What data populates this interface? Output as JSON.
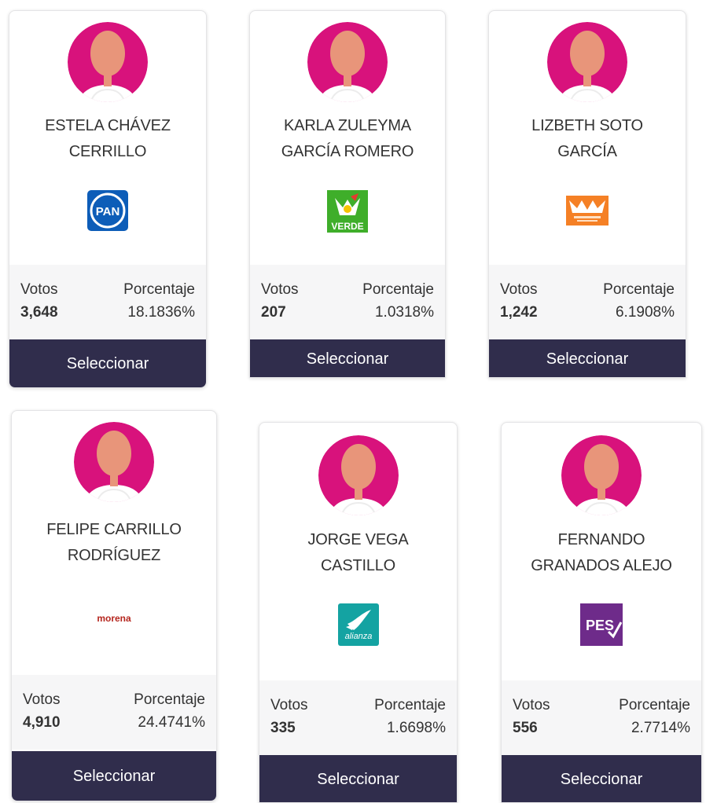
{
  "labels": {
    "votes": "Votos",
    "percent": "Porcentaje",
    "select": "Seleccionar"
  },
  "colors": {
    "avatar_bg": "#d8127c",
    "skin": "#e8957a",
    "button_bg": "#302d4c",
    "stats_bg": "#f6f6f7",
    "pan_blue": "#0d5db8",
    "verde_green": "#3fae2a",
    "mc_orange": "#f58025",
    "morena_red": "#b5261e",
    "alianza_teal": "#14a3a2",
    "pes_purple": "#6e2b8a"
  },
  "candidates": [
    {
      "name_line1": "ESTELA CHÁVEZ",
      "name_line2": "CERRILLO",
      "party": "PAN",
      "party_logo_text": "PAN",
      "party_icon": "pan-logo",
      "votes": "3,648",
      "percent": "18.1836%"
    },
    {
      "name_line1": "KARLA ZULEYMA",
      "name_line2": "GARCÍA ROMERO",
      "party": "VERDE",
      "party_logo_text": "VERDE",
      "party_icon": "verde-logo",
      "votes": "207",
      "percent": "1.0318%"
    },
    {
      "name_line1": "LIZBETH SOTO",
      "name_line2": "GARCÍA",
      "party": "MOVIMIENTO CIUDADANO",
      "party_logo_text": "",
      "party_icon": "movimiento-ciudadano-logo",
      "votes": "1,242",
      "percent": "6.1908%"
    },
    {
      "name_line1": "FELIPE CARRILLO",
      "name_line2": "RODRÍGUEZ",
      "party": "morena",
      "party_logo_text": "morena",
      "party_icon": "morena-logo",
      "votes": "4,910",
      "percent": "24.4741%"
    },
    {
      "name_line1": "JORGE VEGA",
      "name_line2": "CASTILLO",
      "party": "alianza",
      "party_logo_text": "alianza",
      "party_icon": "alianza-logo",
      "votes": "335",
      "percent": "1.6698%"
    },
    {
      "name_line1": "FERNANDO",
      "name_line2": "GRANADOS ALEJO",
      "party": "PES",
      "party_logo_text": "PES",
      "party_icon": "pes-logo",
      "votes": "556",
      "percent": "2.7714%"
    }
  ]
}
